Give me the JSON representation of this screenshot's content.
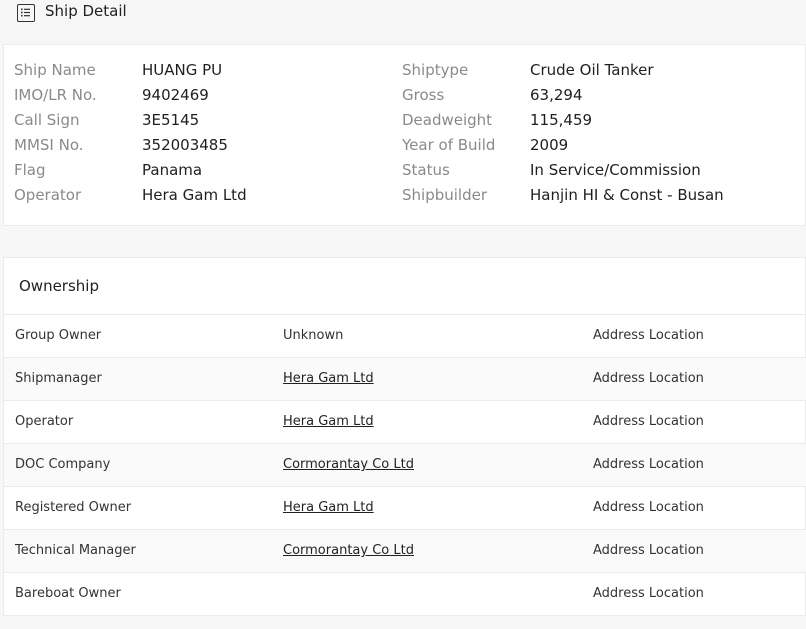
{
  "header": {
    "title": "Ship Detail",
    "icon": "list-icon"
  },
  "detail": {
    "left": [
      {
        "label": "Ship Name",
        "value": "HUANG PU"
      },
      {
        "label": "IMO/LR No.",
        "value": "9402469"
      },
      {
        "label": "Call Sign",
        "value": "3E5145"
      },
      {
        "label": "MMSI No.",
        "value": "352003485"
      },
      {
        "label": "Flag",
        "value": "Panama"
      },
      {
        "label": "Operator",
        "value": "Hera Gam Ltd"
      }
    ],
    "right": [
      {
        "label": "Shiptype",
        "value": "Crude Oil Tanker"
      },
      {
        "label": "Gross",
        "value": "63,294"
      },
      {
        "label": "Deadweight",
        "value": "115,459"
      },
      {
        "label": "Year of Build",
        "value": "2009"
      },
      {
        "label": "Status",
        "value": "In Service/Commission"
      },
      {
        "label": "Shipbuilder",
        "value": "Hanjin HI & Const - Busan"
      }
    ]
  },
  "ownership": {
    "title": "Ownership",
    "rows": [
      {
        "role": "Group Owner",
        "company": "Unknown",
        "company_link": false,
        "address": "Address Location"
      },
      {
        "role": "Shipmanager",
        "company": "Hera Gam Ltd",
        "company_link": true,
        "address": "Address Location"
      },
      {
        "role": "Operator",
        "company": "Hera Gam Ltd",
        "company_link": true,
        "address": "Address Location"
      },
      {
        "role": "DOC Company",
        "company": "Cormorantay Co Ltd",
        "company_link": true,
        "address": "Address Location"
      },
      {
        "role": "Registered Owner",
        "company": "Hera Gam Ltd",
        "company_link": true,
        "address": "Address Location"
      },
      {
        "role": "Technical Manager",
        "company": "Cormorantay Co Ltd",
        "company_link": true,
        "address": "Address Location"
      },
      {
        "role": "Bareboat Owner",
        "company": "",
        "company_link": false,
        "address": "Address Location"
      }
    ]
  }
}
